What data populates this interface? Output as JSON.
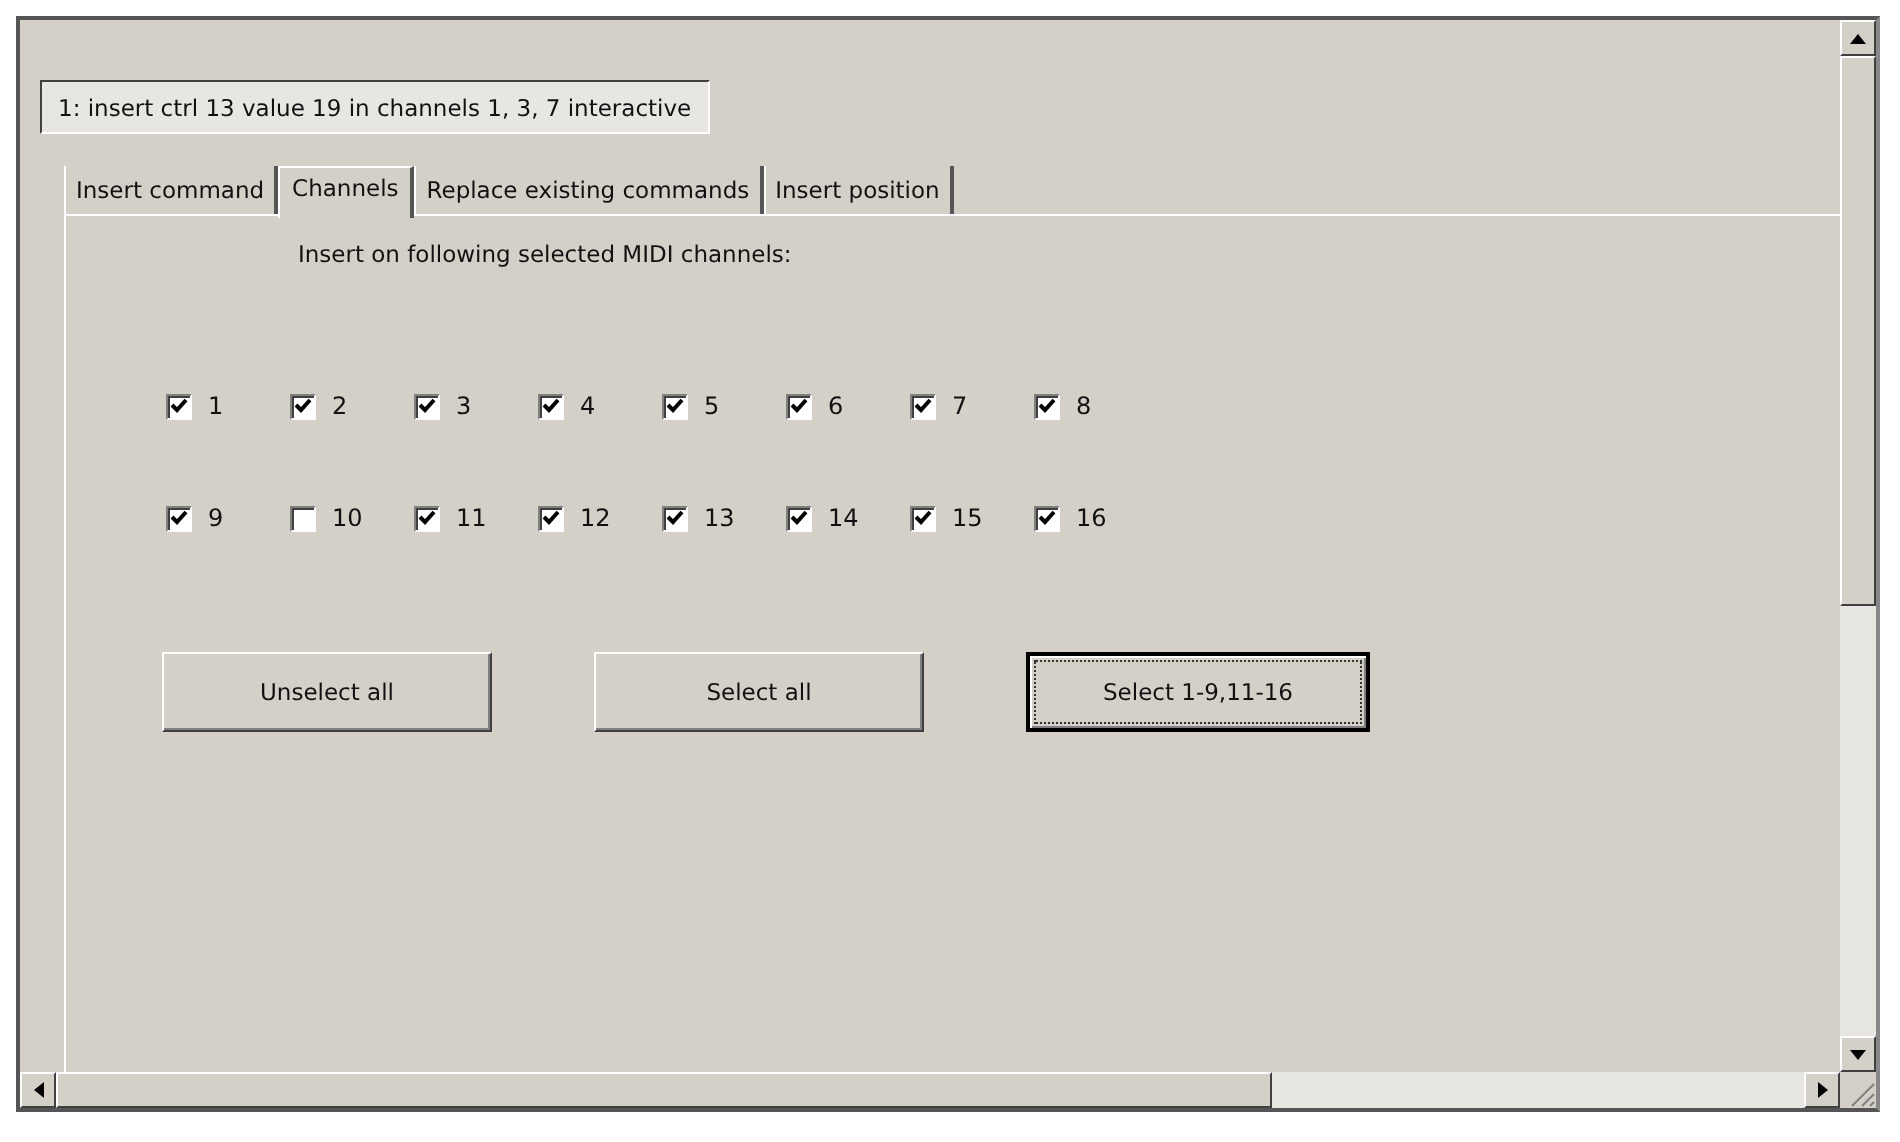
{
  "command_label": "1: insert ctrl 13 value 19 in channels 1, 3, 7 interactive",
  "tabs": [
    {
      "label": "Insert command",
      "selected": false
    },
    {
      "label": "Channels",
      "selected": true
    },
    {
      "label": "Replace existing commands",
      "selected": false
    },
    {
      "label": "Insert position",
      "selected": false
    }
  ],
  "instruction": "Insert on following selected MIDI channels:",
  "channels": [
    {
      "label": "1",
      "checked": true
    },
    {
      "label": "2",
      "checked": true
    },
    {
      "label": "3",
      "checked": true
    },
    {
      "label": "4",
      "checked": true
    },
    {
      "label": "5",
      "checked": true
    },
    {
      "label": "6",
      "checked": true
    },
    {
      "label": "7",
      "checked": true
    },
    {
      "label": "8",
      "checked": true
    },
    {
      "label": "9",
      "checked": true
    },
    {
      "label": "10",
      "checked": false
    },
    {
      "label": "11",
      "checked": true
    },
    {
      "label": "12",
      "checked": true
    },
    {
      "label": "13",
      "checked": true
    },
    {
      "label": "14",
      "checked": true
    },
    {
      "label": "15",
      "checked": true
    },
    {
      "label": "16",
      "checked": true
    }
  ],
  "buttons": [
    {
      "label": "Unselect all",
      "default": false
    },
    {
      "label": "Select all",
      "default": false
    },
    {
      "label": "Select 1-9,11-16",
      "default": true
    }
  ]
}
